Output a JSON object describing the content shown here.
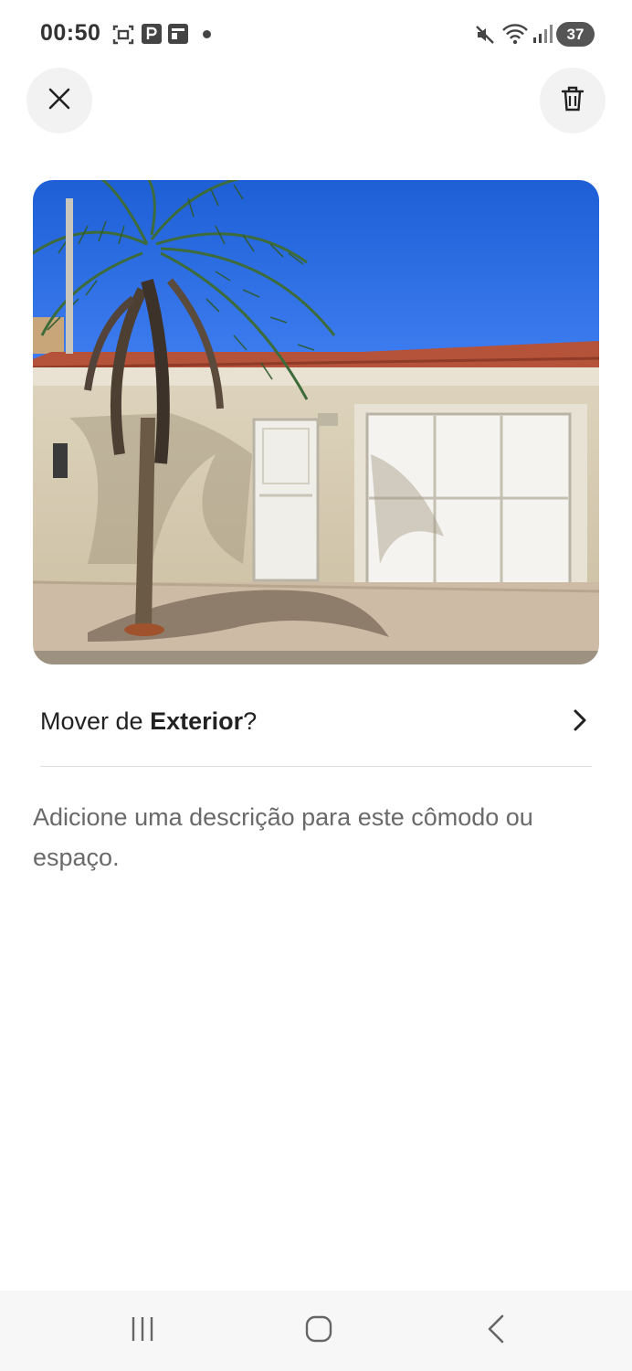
{
  "status_bar": {
    "time": "00:50",
    "battery": "37",
    "icons": [
      "screenshot-icon",
      "parking-app-icon",
      "gallery-app-icon",
      "notification-dot",
      "mute-icon",
      "wifi-icon",
      "signal-icon",
      "battery-icon"
    ]
  },
  "header": {
    "close_icon": "close-icon",
    "delete_icon": "trash-icon"
  },
  "photo": {
    "subject": "house-exterior-photo"
  },
  "move_row": {
    "prefix": "Mover de ",
    "room": "Exterior",
    "suffix": "?",
    "chevron_icon": "chevron-right-icon"
  },
  "description": {
    "placeholder": "Adicione uma descrição para este cômodo ou espaço."
  },
  "nav_bar": {
    "recents_icon": "recents-icon",
    "home_icon": "home-icon",
    "back_icon": "back-icon"
  },
  "colors": {
    "background": "#ffffff",
    "circle_button": "#f2f2f2",
    "text_primary": "#222222",
    "text_secondary": "#6a6a6a",
    "divider": "#dddddd"
  }
}
